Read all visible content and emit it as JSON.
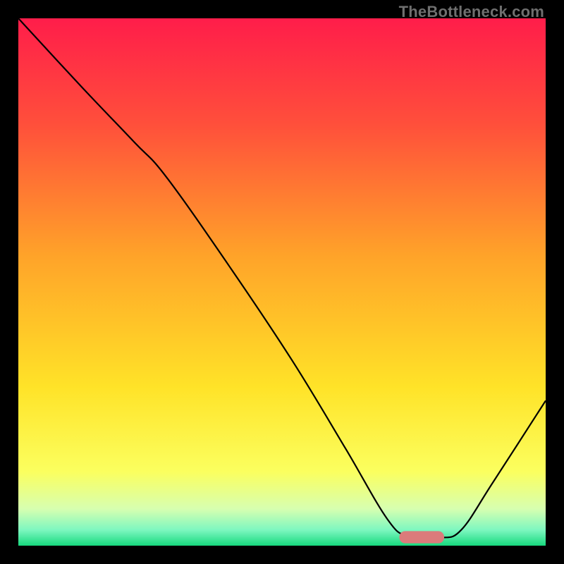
{
  "watermark": "TheBottleneck.com",
  "chart_data": {
    "type": "line",
    "title": "",
    "xlabel": "",
    "ylabel": "",
    "xlim": [
      0,
      100
    ],
    "ylim": [
      0,
      100
    ],
    "background_gradient": {
      "stops": [
        {
          "offset": 0.0,
          "color": "#ff1d4a"
        },
        {
          "offset": 0.2,
          "color": "#ff4f3b"
        },
        {
          "offset": 0.45,
          "color": "#ffa329"
        },
        {
          "offset": 0.7,
          "color": "#ffe328"
        },
        {
          "offset": 0.86,
          "color": "#fbff5f"
        },
        {
          "offset": 0.93,
          "color": "#d7ffb0"
        },
        {
          "offset": 0.97,
          "color": "#7ef7c0"
        },
        {
          "offset": 1.0,
          "color": "#17d97e"
        }
      ]
    },
    "series": [
      {
        "name": "curve",
        "color": "#000000",
        "width": 2.2,
        "points": [
          {
            "x": 0.0,
            "y": 100.0
          },
          {
            "x": 12.0,
            "y": 87.0
          },
          {
            "x": 22.0,
            "y": 76.5
          },
          {
            "x": 28.0,
            "y": 70.0
          },
          {
            "x": 40.0,
            "y": 53.0
          },
          {
            "x": 52.0,
            "y": 35.0
          },
          {
            "x": 62.0,
            "y": 18.5
          },
          {
            "x": 70.0,
            "y": 5.0
          },
          {
            "x": 74.0,
            "y": 1.8
          },
          {
            "x": 80.0,
            "y": 1.5
          },
          {
            "x": 84.0,
            "y": 3.0
          },
          {
            "x": 90.0,
            "y": 12.0
          },
          {
            "x": 100.0,
            "y": 27.5
          }
        ]
      }
    ],
    "marker": {
      "shape": "rounded-rect",
      "color": "#db7b7b",
      "x": 76.5,
      "y": 1.6,
      "width": 8.5,
      "height": 2.3,
      "rx": 1.1
    }
  }
}
